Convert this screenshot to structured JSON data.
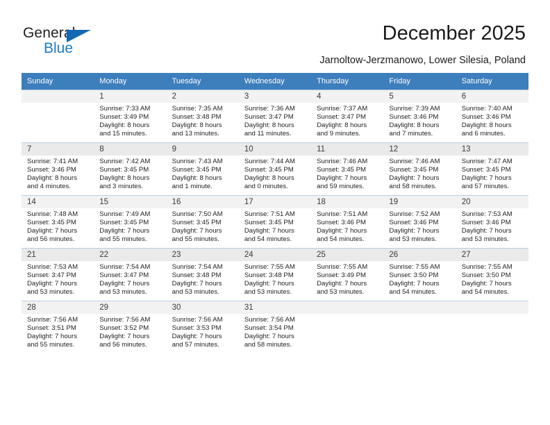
{
  "brand": {
    "name_top": "General",
    "name_bottom": "Blue",
    "color_blue": "#1b7cc4",
    "color_triangle": "#1268b3",
    "color_dark": "#231f20"
  },
  "header": {
    "title": "December 2025",
    "subtitle": "Jarnoltow-Jerzmanowo, Lower Silesia, Poland"
  },
  "calendar": {
    "header_bg": "#3d7ebd",
    "weekday_headers": [
      "Sunday",
      "Monday",
      "Tuesday",
      "Wednesday",
      "Thursday",
      "Friday",
      "Saturday"
    ],
    "weeks": [
      {
        "shaded": false,
        "days": [
          {
            "day": "",
            "lines": []
          },
          {
            "day": "1",
            "lines": [
              "Sunrise: 7:33 AM",
              "Sunset: 3:49 PM",
              "Daylight: 8 hours",
              "and 15 minutes."
            ]
          },
          {
            "day": "2",
            "lines": [
              "Sunrise: 7:35 AM",
              "Sunset: 3:48 PM",
              "Daylight: 8 hours",
              "and 13 minutes."
            ]
          },
          {
            "day": "3",
            "lines": [
              "Sunrise: 7:36 AM",
              "Sunset: 3:47 PM",
              "Daylight: 8 hours",
              "and 11 minutes."
            ]
          },
          {
            "day": "4",
            "lines": [
              "Sunrise: 7:37 AM",
              "Sunset: 3:47 PM",
              "Daylight: 8 hours",
              "and 9 minutes."
            ]
          },
          {
            "day": "5",
            "lines": [
              "Sunrise: 7:39 AM",
              "Sunset: 3:46 PM",
              "Daylight: 8 hours",
              "and 7 minutes."
            ]
          },
          {
            "day": "6",
            "lines": [
              "Sunrise: 7:40 AM",
              "Sunset: 3:46 PM",
              "Daylight: 8 hours",
              "and 6 minutes."
            ]
          }
        ]
      },
      {
        "shaded": true,
        "days": [
          {
            "day": "7",
            "lines": [
              "Sunrise: 7:41 AM",
              "Sunset: 3:46 PM",
              "Daylight: 8 hours",
              "and 4 minutes."
            ]
          },
          {
            "day": "8",
            "lines": [
              "Sunrise: 7:42 AM",
              "Sunset: 3:45 PM",
              "Daylight: 8 hours",
              "and 3 minutes."
            ]
          },
          {
            "day": "9",
            "lines": [
              "Sunrise: 7:43 AM",
              "Sunset: 3:45 PM",
              "Daylight: 8 hours",
              "and 1 minute."
            ]
          },
          {
            "day": "10",
            "lines": [
              "Sunrise: 7:44 AM",
              "Sunset: 3:45 PM",
              "Daylight: 8 hours",
              "and 0 minutes."
            ]
          },
          {
            "day": "11",
            "lines": [
              "Sunrise: 7:46 AM",
              "Sunset: 3:45 PM",
              "Daylight: 7 hours",
              "and 59 minutes."
            ]
          },
          {
            "day": "12",
            "lines": [
              "Sunrise: 7:46 AM",
              "Sunset: 3:45 PM",
              "Daylight: 7 hours",
              "and 58 minutes."
            ]
          },
          {
            "day": "13",
            "lines": [
              "Sunrise: 7:47 AM",
              "Sunset: 3:45 PM",
              "Daylight: 7 hours",
              "and 57 minutes."
            ]
          }
        ]
      },
      {
        "shaded": false,
        "days": [
          {
            "day": "14",
            "lines": [
              "Sunrise: 7:48 AM",
              "Sunset: 3:45 PM",
              "Daylight: 7 hours",
              "and 56 minutes."
            ]
          },
          {
            "day": "15",
            "lines": [
              "Sunrise: 7:49 AM",
              "Sunset: 3:45 PM",
              "Daylight: 7 hours",
              "and 55 minutes."
            ]
          },
          {
            "day": "16",
            "lines": [
              "Sunrise: 7:50 AM",
              "Sunset: 3:45 PM",
              "Daylight: 7 hours",
              "and 55 minutes."
            ]
          },
          {
            "day": "17",
            "lines": [
              "Sunrise: 7:51 AM",
              "Sunset: 3:45 PM",
              "Daylight: 7 hours",
              "and 54 minutes."
            ]
          },
          {
            "day": "18",
            "lines": [
              "Sunrise: 7:51 AM",
              "Sunset: 3:46 PM",
              "Daylight: 7 hours",
              "and 54 minutes."
            ]
          },
          {
            "day": "19",
            "lines": [
              "Sunrise: 7:52 AM",
              "Sunset: 3:46 PM",
              "Daylight: 7 hours",
              "and 53 minutes."
            ]
          },
          {
            "day": "20",
            "lines": [
              "Sunrise: 7:53 AM",
              "Sunset: 3:46 PM",
              "Daylight: 7 hours",
              "and 53 minutes."
            ]
          }
        ]
      },
      {
        "shaded": true,
        "days": [
          {
            "day": "21",
            "lines": [
              "Sunrise: 7:53 AM",
              "Sunset: 3:47 PM",
              "Daylight: 7 hours",
              "and 53 minutes."
            ]
          },
          {
            "day": "22",
            "lines": [
              "Sunrise: 7:54 AM",
              "Sunset: 3:47 PM",
              "Daylight: 7 hours",
              "and 53 minutes."
            ]
          },
          {
            "day": "23",
            "lines": [
              "Sunrise: 7:54 AM",
              "Sunset: 3:48 PM",
              "Daylight: 7 hours",
              "and 53 minutes."
            ]
          },
          {
            "day": "24",
            "lines": [
              "Sunrise: 7:55 AM",
              "Sunset: 3:48 PM",
              "Daylight: 7 hours",
              "and 53 minutes."
            ]
          },
          {
            "day": "25",
            "lines": [
              "Sunrise: 7:55 AM",
              "Sunset: 3:49 PM",
              "Daylight: 7 hours",
              "and 53 minutes."
            ]
          },
          {
            "day": "26",
            "lines": [
              "Sunrise: 7:55 AM",
              "Sunset: 3:50 PM",
              "Daylight: 7 hours",
              "and 54 minutes."
            ]
          },
          {
            "day": "27",
            "lines": [
              "Sunrise: 7:55 AM",
              "Sunset: 3:50 PM",
              "Daylight: 7 hours",
              "and 54 minutes."
            ]
          }
        ]
      },
      {
        "shaded": false,
        "days": [
          {
            "day": "28",
            "lines": [
              "Sunrise: 7:56 AM",
              "Sunset: 3:51 PM",
              "Daylight: 7 hours",
              "and 55 minutes."
            ]
          },
          {
            "day": "29",
            "lines": [
              "Sunrise: 7:56 AM",
              "Sunset: 3:52 PM",
              "Daylight: 7 hours",
              "and 56 minutes."
            ]
          },
          {
            "day": "30",
            "lines": [
              "Sunrise: 7:56 AM",
              "Sunset: 3:53 PM",
              "Daylight: 7 hours",
              "and 57 minutes."
            ]
          },
          {
            "day": "31",
            "lines": [
              "Sunrise: 7:56 AM",
              "Sunset: 3:54 PM",
              "Daylight: 7 hours",
              "and 58 minutes."
            ]
          },
          {
            "day": "",
            "lines": []
          },
          {
            "day": "",
            "lines": []
          },
          {
            "day": "",
            "lines": []
          }
        ]
      }
    ]
  }
}
